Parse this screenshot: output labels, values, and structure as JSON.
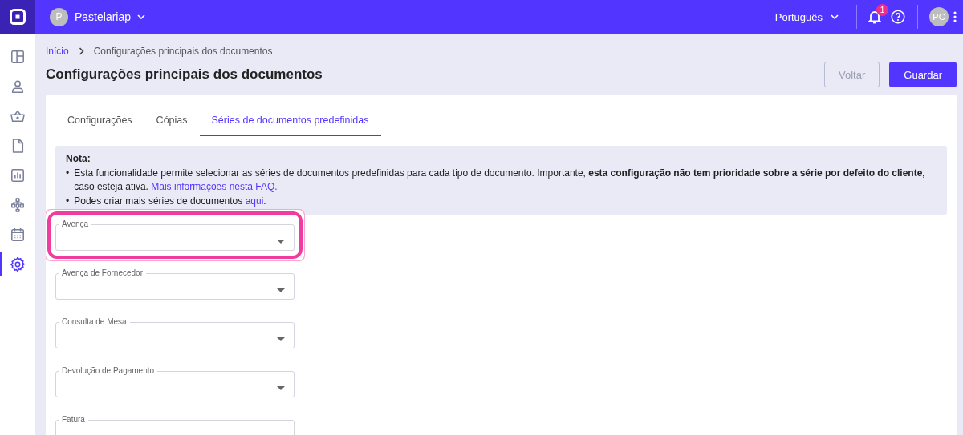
{
  "topbar": {
    "company": {
      "initial": "P",
      "name": "Pastelariap"
    },
    "language": "Português",
    "notifications": {
      "count": "1"
    },
    "user_initials": "PC"
  },
  "sidebar": {
    "items": [
      {
        "kind": "dashboard",
        "selected": false
      },
      {
        "kind": "user",
        "selected": false
      },
      {
        "kind": "basket",
        "selected": false
      },
      {
        "kind": "document",
        "selected": false
      },
      {
        "kind": "chart",
        "selected": false
      },
      {
        "kind": "network",
        "selected": false
      },
      {
        "kind": "calendar",
        "selected": false
      },
      {
        "kind": "settings",
        "selected": true
      }
    ]
  },
  "breadcrumb": [
    {
      "label": "Início",
      "kind": "link"
    },
    {
      "label": "Configurações principais dos documentos",
      "kind": "current"
    }
  ],
  "title": "Configurações principais dos documentos",
  "buttons": [
    {
      "label": "Voltar",
      "kind": "secondary"
    },
    {
      "label": "Guardar",
      "kind": "primary"
    }
  ],
  "tabs": [
    {
      "label": "Configurações",
      "selected": false
    },
    {
      "label": "Cópias",
      "selected": false
    },
    {
      "label": "Séries de documentos predefinidas",
      "selected": true
    }
  ],
  "note": {
    "heading": "Nota:",
    "bullets": [
      {
        "marker": "•",
        "text": "Esta funcionalidade permite selecionar as séries de documentos predefinidas para cada tipo de documento. Importante, **esta configuração não tem prioridade sobre a série por defeito do cliente,** caso esteja ativa.",
        "link": "Mais informações nesta FAQ."
      },
      {
        "marker": "•",
        "text": "Podes criar mais séries de documentos",
        "link": "aqui",
        "after": "."
      }
    ]
  },
  "fields": [
    {
      "label": "Avença",
      "highlighted": true
    },
    {
      "label": "Avença de Fornecedor",
      "highlighted": false
    },
    {
      "label": "Consulta de Mesa",
      "highlighted": false
    },
    {
      "label": "Devolução de Pagamento",
      "highlighted": false
    },
    {
      "label": "Fatura",
      "highlighted": false
    }
  ]
}
